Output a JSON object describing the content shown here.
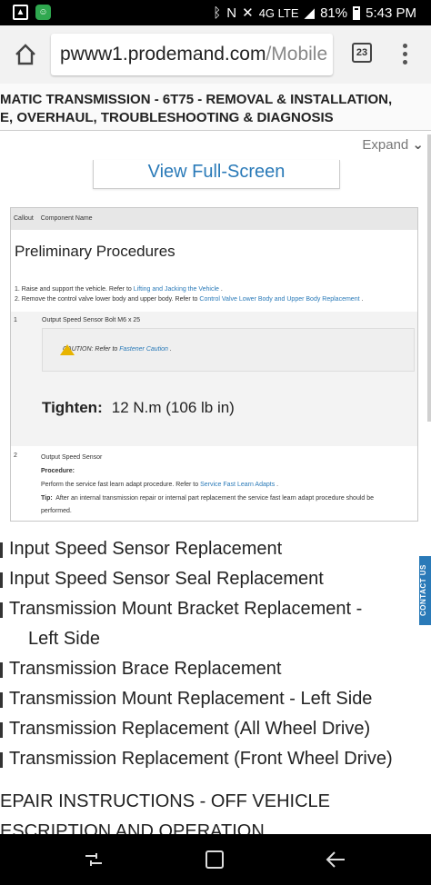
{
  "status_bar": {
    "battery": "81%",
    "time": "5:43 PM",
    "network": "4G LTE"
  },
  "browser": {
    "url_main": "pwww1.prodemand.com",
    "url_dim": "/Mobile",
    "tab_count": "23"
  },
  "heading": {
    "line1": "MATIC TRANSMISSION - 6T75 - REMOVAL & INSTALLATION,",
    "line2": "E, OVERHAUL, TROUBLESHOOTING & DIAGNOSIS"
  },
  "expand_label": "Expand",
  "fullscreen_label": "View Full-Screen",
  "doc": {
    "col_callout": "Callout",
    "col_component": "Component Name",
    "prelim_title": "Preliminary Procedures",
    "step1_text": "1. Raise and support the vehicle. Refer to",
    "step1_link": "Lifting and Jacking the Vehicle",
    "step2_text": "2. Remove the control valve lower body and upper body. Refer to",
    "step2_link": "Control Valve Lower Body and Upper Body Replacement",
    "row1_num": "1",
    "row1_component": "Output Speed Sensor Bolt M6 x 25",
    "caution_text": "CAUTION: Refer to",
    "caution_link": "Fastener Caution",
    "tighten_label": "Tighten:",
    "tighten_value": "12 N.m (106 lb in)",
    "row2_num": "2",
    "row2_component": "Output Speed Sensor",
    "procedure_label": "Procedure:",
    "procedure_text": "Perform the service fast learn adapt procedure. Refer to",
    "procedure_link": "Service Fast Learn Adapts",
    "tip_label": "Tip:",
    "tip_text": "After an internal transmission repair or internal part replacement the service fast learn adapt procedure should be",
    "tip_text2": "performed."
  },
  "list": [
    "Input Speed Sensor Replacement",
    "Input Speed Sensor Seal Replacement",
    "Transmission Mount Bracket Replacement -",
    "Left Side",
    "Transmission Brace Replacement",
    "Transmission Mount Replacement - Left Side",
    "Transmission Replacement (All Wheel Drive)",
    "Transmission Replacement (Front Wheel Drive)"
  ],
  "contact_label": "CONTACT US",
  "footer": {
    "line1": "EPAIR INSTRUCTIONS - OFF VEHICLE",
    "line2": "ESCRIPTION AND OPERATION"
  }
}
